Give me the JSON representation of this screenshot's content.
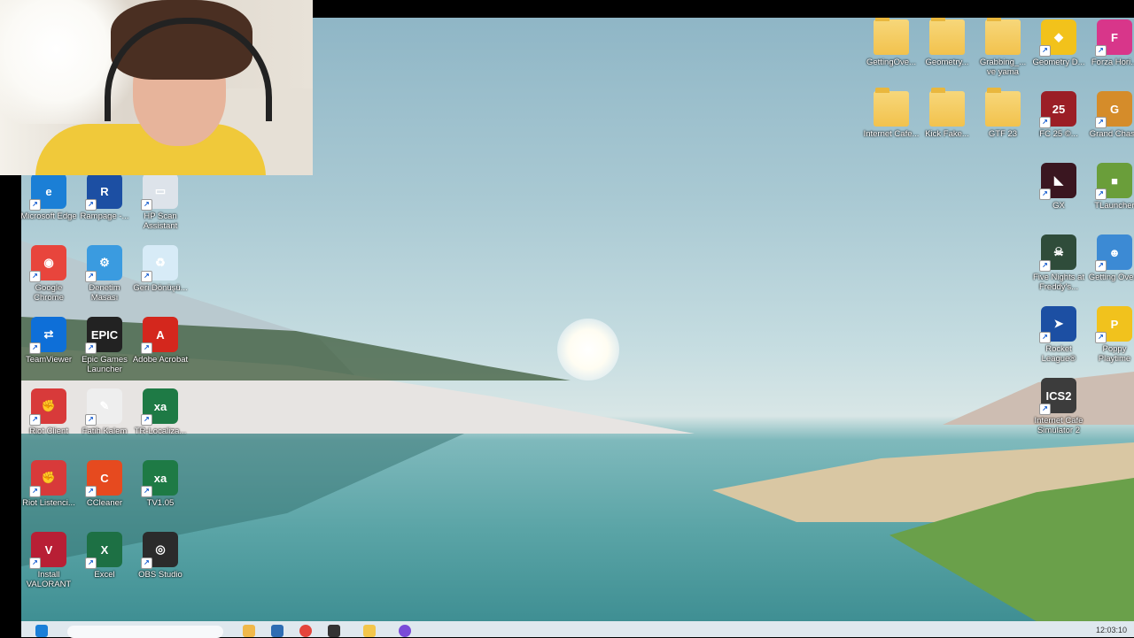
{
  "left_icons": [
    {
      "id": "edge",
      "label": "Microsoft Edge",
      "color": "#1b7fd6",
      "glyph": "e",
      "icon": "edge-icon"
    },
    {
      "id": "rampage",
      "label": "Rampage -...",
      "color": "#1c4fa3",
      "glyph": "R",
      "icon": "rampage-icon"
    },
    {
      "id": "hpscan",
      "label": "HP Scan Assistant",
      "color": "#dde3ea",
      "glyph": "▭",
      "icon": "hp-scan-icon"
    },
    {
      "id": "chrome",
      "label": "Google Chrome",
      "color": "#e8453c",
      "glyph": "◉",
      "icon": "chrome-icon"
    },
    {
      "id": "denetim",
      "label": "Denetim Masası",
      "color": "#3a9be0",
      "glyph": "⚙",
      "icon": "control-panel-icon"
    },
    {
      "id": "recycle",
      "label": "Geri Dönüşü...",
      "color": "#d7ebf7",
      "glyph": "♻",
      "icon": "recycle-bin-icon"
    },
    {
      "id": "teamviewer",
      "label": "TeamViewer",
      "color": "#0e6fd8",
      "glyph": "⇄",
      "icon": "teamviewer-icon"
    },
    {
      "id": "epic",
      "label": "Epic Games Launcher",
      "color": "#222222",
      "glyph": "EPIC",
      "icon": "epic-games-icon"
    },
    {
      "id": "acrobat",
      "label": "Adobe Acrobat",
      "color": "#d4271d",
      "glyph": "A",
      "icon": "acrobat-icon"
    },
    {
      "id": "riotclient",
      "label": "Riot Client",
      "color": "#d83a3a",
      "glyph": "✊",
      "icon": "riot-client-icon"
    },
    {
      "id": "fatih",
      "label": "Fatih Kalem",
      "color": "#eeeeee",
      "glyph": "✎",
      "icon": "fatih-kalem-icon"
    },
    {
      "id": "trlocal",
      "label": "TR-Localiza...",
      "color": "#1e7a45",
      "glyph": "xa",
      "icon": "excel-file-icon"
    },
    {
      "id": "riotlisten",
      "label": "Riot Listenci...",
      "color": "#d83a3a",
      "glyph": "✊",
      "icon": "riot-listener-icon"
    },
    {
      "id": "ccleaner",
      "label": "CCleaner",
      "color": "#e64a1f",
      "glyph": "C",
      "icon": "ccleaner-icon"
    },
    {
      "id": "tv105",
      "label": "TV1.05",
      "color": "#1e7a45",
      "glyph": "xa",
      "icon": "excel-file-icon"
    },
    {
      "id": "valorant",
      "label": "Install VALORANT",
      "color": "#b81f35",
      "glyph": "V",
      "icon": "valorant-icon"
    },
    {
      "id": "excel",
      "label": "Excel",
      "color": "#1d7044",
      "glyph": "X",
      "icon": "excel-icon"
    },
    {
      "id": "obs",
      "label": "OBS Studio",
      "color": "#2b2b2b",
      "glyph": "◎",
      "icon": "obs-icon"
    }
  ],
  "right_icons": [
    {
      "id": "f1",
      "label": "GettingOve...",
      "color": "folder",
      "glyph": "",
      "icon": "folder-icon"
    },
    {
      "id": "f2",
      "label": "Geometry...",
      "color": "folder",
      "glyph": "",
      "icon": "folder-icon"
    },
    {
      "id": "f3",
      "label": "Grabbing_... ve yama",
      "color": "folder",
      "glyph": "",
      "icon": "folder-icon"
    },
    {
      "id": "gd",
      "label": "Geometry D...",
      "color": "#f2c21b",
      "glyph": "◆",
      "icon": "geometry-dash-icon"
    },
    {
      "id": "forza",
      "label": "Forza Hori...",
      "color": "#d8368a",
      "glyph": "F",
      "icon": "forza-icon"
    },
    {
      "id": "f4",
      "label": "Internet Cafe...",
      "color": "folder",
      "glyph": "",
      "icon": "folder-icon"
    },
    {
      "id": "f5",
      "label": "Kick Fake...",
      "color": "folder",
      "glyph": "",
      "icon": "folder-icon"
    },
    {
      "id": "f6",
      "label": "GTF 23",
      "color": "folder",
      "glyph": "",
      "icon": "folder-icon"
    },
    {
      "id": "fc25",
      "label": "FC 25 ©...",
      "color": "#9b1e26",
      "glyph": "25",
      "icon": "fc25-icon"
    },
    {
      "id": "grandchase",
      "label": "Grand Chase",
      "color": "#d58c2a",
      "glyph": "G",
      "icon": "grand-chase-icon"
    },
    {
      "id": "gx",
      "label": "GX",
      "color": "#3a1620",
      "glyph": "◣",
      "icon": "opera-gx-icon"
    },
    {
      "id": "tlauncher",
      "label": "TLauncher",
      "color": "#6a9e3a",
      "glyph": "■",
      "icon": "tlauncher-icon"
    },
    {
      "id": "pvz",
      "label": "Five Nights at Freddy's...",
      "color": "#2f4c3a",
      "glyph": "☠",
      "icon": "game-icon"
    },
    {
      "id": "gettingover",
      "label": "Getting Ove...",
      "color": "#3c8ad4",
      "glyph": "☻",
      "icon": "getting-over-it-icon"
    },
    {
      "id": "rocket",
      "label": "Rocket League®",
      "color": "#1c4fa3",
      "glyph": "➤",
      "icon": "rocket-league-icon"
    },
    {
      "id": "poppy",
      "label": "Poppy Playtime",
      "color": "#f1c21d",
      "glyph": "P",
      "icon": "poppy-playtime-icon"
    },
    {
      "id": "ics",
      "label": "Internet Cafe Simulator 2",
      "color": "#3c3c3c",
      "glyph": "ICS2",
      "icon": "ics2-icon"
    }
  ],
  "taskbar": {
    "clock": "12:03:10"
  }
}
